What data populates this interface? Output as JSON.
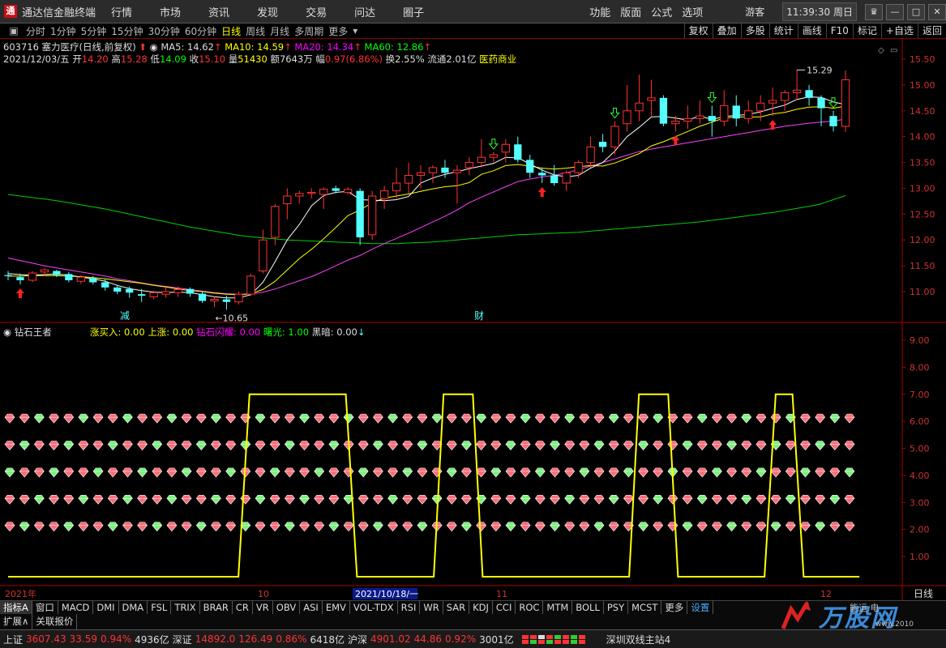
{
  "titlebar": {
    "app_title": "通达信金融终端",
    "menu": [
      "行情",
      "市场",
      "资讯",
      "发现",
      "交易",
      "问达",
      "圈子"
    ],
    "tools": [
      "功能",
      "版面",
      "公式",
      "选项"
    ],
    "user": "游客",
    "clock": "11:39:30 周日",
    "win_buttons": [
      "skin-icon",
      "minimize-icon",
      "maximize-icon",
      "close-icon"
    ]
  },
  "period_bar": {
    "items": [
      "分时",
      "1分钟",
      "5分钟",
      "15分钟",
      "30分钟",
      "60分钟",
      "日线",
      "周线",
      "月线",
      "多周期",
      "更多"
    ],
    "active": "日线",
    "right_tools": [
      "复权",
      "叠加",
      "多股",
      "统计",
      "画线",
      "F10",
      "标记",
      "+自选",
      "返回"
    ]
  },
  "stock": {
    "code_name": "603716 塞力医疗(日线,前复权)",
    "ma5": "MA5: 14.62",
    "ma10": "MA10: 14.59",
    "ma20": "MA20: 14.34",
    "ma60": "MA60: 12.86",
    "date": "2021/12/03/五",
    "open_lbl": "开",
    "open": "14.20",
    "high_lbl": "高",
    "high": "15.28",
    "low_lbl": "低",
    "low": "14.09",
    "close_lbl": "收",
    "close": "15.10",
    "vol_lbl": "量",
    "vol": "51430",
    "amt_lbl": "额",
    "amt": "7643万",
    "chg_lbl": "幅",
    "chg": "0.97(6.86%)",
    "turnover": "换2.55%",
    "float": "流通2.01亿",
    "sector": "医药商业"
  },
  "indicator": {
    "name": "钻石王者",
    "zmr": "涨买入: 0.00",
    "sz": "上涨: 0.00",
    "zsxy": "钻石闪耀: 0.00",
    "sg": "曙光: 1.00",
    "ha": "黑暗: 0.00"
  },
  "chart_data": {
    "type": "candlestick",
    "price_axis": {
      "ticks": [
        "15.50",
        "15.00",
        "14.50",
        "14.00",
        "13.50",
        "13.00",
        "12.50",
        "12.00",
        "11.50",
        "11.00"
      ]
    },
    "indicator_axis": {
      "ticks": [
        "9.00",
        "8.00",
        "7.00",
        "6.00",
        "5.00",
        "4.00",
        "3.00",
        "2.00",
        "1.00"
      ],
      "range": [
        0,
        9.5
      ]
    },
    "price_range": [
      10.5,
      15.7
    ],
    "annotations": {
      "low_label": "←10.65",
      "high_label": "15.29",
      "jian": "减",
      "cai": "财"
    },
    "x_axis_labels": {
      "year": "2021年",
      "oct": "10",
      "nov": "11",
      "dec": "12",
      "cursor_date": "2021/10/18/一",
      "period": "日线"
    },
    "candles": [
      [
        11.32,
        11.4,
        11.22,
        11.3
      ],
      [
        11.28,
        11.35,
        11.14,
        11.22
      ],
      [
        11.22,
        11.4,
        11.18,
        11.36
      ],
      [
        11.38,
        11.45,
        11.3,
        11.42
      ],
      [
        11.4,
        11.42,
        11.28,
        11.32
      ],
      [
        11.34,
        11.38,
        11.18,
        11.22
      ],
      [
        11.2,
        11.32,
        11.15,
        11.28
      ],
      [
        11.26,
        11.3,
        11.14,
        11.18
      ],
      [
        11.18,
        11.24,
        11.02,
        11.08
      ],
      [
        11.08,
        11.12,
        10.95,
        11.0
      ],
      [
        11.05,
        11.1,
        10.88,
        10.98
      ],
      [
        10.95,
        11.05,
        10.8,
        10.92
      ],
      [
        10.9,
        11.02,
        10.85,
        10.98
      ],
      [
        10.95,
        11.08,
        10.88,
        11.0
      ],
      [
        10.98,
        11.1,
        10.9,
        11.04
      ],
      [
        11.05,
        11.08,
        10.9,
        10.96
      ],
      [
        10.96,
        11.0,
        10.78,
        10.82
      ],
      [
        10.82,
        10.9,
        10.7,
        10.85
      ],
      [
        10.85,
        10.92,
        10.65,
        10.8
      ],
      [
        10.8,
        11.0,
        10.75,
        10.95
      ],
      [
        10.95,
        11.35,
        10.92,
        11.3
      ],
      [
        11.4,
        12.2,
        11.35,
        12.0
      ],
      [
        12.05,
        12.7,
        11.9,
        12.65
      ],
      [
        12.7,
        13.0,
        12.4,
        12.85
      ],
      [
        12.85,
        12.95,
        12.7,
        12.9
      ],
      [
        12.9,
        13.0,
        12.8,
        12.92
      ],
      [
        12.88,
        13.02,
        12.6,
        12.98
      ],
      [
        13.0,
        13.05,
        12.9,
        12.95
      ],
      [
        12.92,
        13.02,
        12.88,
        12.98
      ],
      [
        12.95,
        13.0,
        11.9,
        12.05
      ],
      [
        12.1,
        12.95,
        12.0,
        12.85
      ],
      [
        12.8,
        13.05,
        12.6,
        12.95
      ],
      [
        12.95,
        13.4,
        12.8,
        13.1
      ],
      [
        13.1,
        13.5,
        12.9,
        13.25
      ],
      [
        13.25,
        13.45,
        13.0,
        13.3
      ],
      [
        13.3,
        13.45,
        13.1,
        13.4
      ],
      [
        13.4,
        13.55,
        13.2,
        13.3
      ],
      [
        13.3,
        13.45,
        12.7,
        13.35
      ],
      [
        13.4,
        13.6,
        13.25,
        13.5
      ],
      [
        13.5,
        13.95,
        13.4,
        13.6
      ],
      [
        13.6,
        13.7,
        13.5,
        13.65
      ],
      [
        13.7,
        13.95,
        13.5,
        13.85
      ],
      [
        13.85,
        14.0,
        13.5,
        13.55
      ],
      [
        13.55,
        13.65,
        13.2,
        13.3
      ],
      [
        13.3,
        13.4,
        13.1,
        13.25
      ],
      [
        13.25,
        13.45,
        13.05,
        13.1
      ],
      [
        13.1,
        13.35,
        12.95,
        13.3
      ],
      [
        13.3,
        13.55,
        13.2,
        13.5
      ],
      [
        13.5,
        14.0,
        13.4,
        13.8
      ],
      [
        13.9,
        14.05,
        13.7,
        13.8
      ],
      [
        13.8,
        14.3,
        13.65,
        14.2
      ],
      [
        14.25,
        15.0,
        14.1,
        14.5
      ],
      [
        14.5,
        15.2,
        14.3,
        14.65
      ],
      [
        14.7,
        15.1,
        14.4,
        14.75
      ],
      [
        14.75,
        14.8,
        14.2,
        14.25
      ],
      [
        14.25,
        14.4,
        14.1,
        14.3
      ],
      [
        14.3,
        14.6,
        14.15,
        14.35
      ],
      [
        14.35,
        14.7,
        14.25,
        14.4
      ],
      [
        14.4,
        14.6,
        14.0,
        14.3
      ],
      [
        14.3,
        14.9,
        14.2,
        14.6
      ],
      [
        14.6,
        14.8,
        14.2,
        14.35
      ],
      [
        14.35,
        14.7,
        14.25,
        14.5
      ],
      [
        14.5,
        14.8,
        14.3,
        14.65
      ],
      [
        14.65,
        14.95,
        14.4,
        14.7
      ],
      [
        14.7,
        14.9,
        14.5,
        14.85
      ],
      [
        14.85,
        15.29,
        14.7,
        14.9
      ],
      [
        14.9,
        15.0,
        14.6,
        14.75
      ],
      [
        14.75,
        14.8,
        14.2,
        14.55
      ],
      [
        14.4,
        14.5,
        14.1,
        14.2
      ],
      [
        14.2,
        15.28,
        14.09,
        15.1
      ]
    ],
    "ma5": [
      11.35,
      11.33,
      11.32,
      11.33,
      11.34,
      11.32,
      11.28,
      11.25,
      11.2,
      11.12,
      11.06,
      11.02,
      10.99,
      10.98,
      10.99,
      10.98,
      10.94,
      10.9,
      10.88,
      10.88,
      10.94,
      11.18,
      11.58,
      12.0,
      12.3,
      12.66,
      12.86,
      12.92,
      12.94,
      12.78,
      12.77,
      12.76,
      12.78,
      12.84,
      13.1,
      13.2,
      13.27,
      13.32,
      13.38,
      13.43,
      13.48,
      13.6,
      13.59,
      13.47,
      13.35,
      13.26,
      13.22,
      13.25,
      13.39,
      13.5,
      13.72,
      14.0,
      14.18,
      14.38,
      14.39,
      14.36,
      14.32,
      14.4,
      14.33,
      14.39,
      14.41,
      14.43,
      14.48,
      14.55,
      14.61,
      14.72,
      14.77,
      14.76,
      14.67,
      14.62
    ],
    "ma10": [
      11.3,
      11.3,
      11.31,
      11.31,
      11.31,
      11.3,
      11.29,
      11.27,
      11.25,
      11.22,
      11.19,
      11.16,
      11.12,
      11.09,
      11.05,
      11.02,
      11.0,
      10.97,
      10.95,
      10.94,
      10.96,
      11.04,
      11.2,
      11.42,
      11.64,
      11.82,
      12.02,
      12.24,
      12.47,
      12.58,
      12.72,
      12.81,
      12.85,
      12.89,
      12.94,
      12.99,
      13.03,
      13.05,
      13.11,
      13.27,
      13.34,
      13.44,
      13.46,
      13.43,
      13.39,
      13.37,
      13.39,
      13.42,
      13.44,
      13.43,
      13.49,
      13.58,
      13.67,
      13.82,
      13.9,
      14.0,
      14.1,
      14.2,
      14.28,
      14.36,
      14.38,
      14.38,
      14.38,
      14.44,
      14.47,
      14.53,
      14.57,
      14.58,
      14.55,
      14.59
    ],
    "ma20": [
      11.65,
      11.6,
      11.55,
      11.5,
      11.46,
      11.42,
      11.38,
      11.34,
      11.3,
      11.25,
      11.21,
      11.17,
      11.13,
      11.1,
      11.07,
      11.04,
      11.01,
      10.98,
      10.96,
      10.95,
      10.95,
      10.99,
      11.05,
      11.13,
      11.21,
      11.29,
      11.39,
      11.5,
      11.61,
      11.7,
      11.82,
      11.93,
      12.03,
      12.13,
      12.24,
      12.35,
      12.46,
      12.58,
      12.72,
      12.83,
      12.93,
      13.03,
      13.13,
      13.18,
      13.22,
      13.25,
      13.3,
      13.36,
      13.43,
      13.5,
      13.57,
      13.64,
      13.71,
      13.76,
      13.8,
      13.84,
      13.88,
      13.92,
      13.96,
      14.0,
      14.04,
      14.08,
      14.12,
      14.16,
      14.2,
      14.23,
      14.26,
      14.28,
      14.3,
      14.34
    ],
    "ma60": [
      12.88,
      12.85,
      12.82,
      12.79,
      12.76,
      12.72,
      12.68,
      12.64,
      12.6,
      12.55,
      12.5,
      12.45,
      12.4,
      12.35,
      12.3,
      12.25,
      12.21,
      12.17,
      12.13,
      12.09,
      12.06,
      12.04,
      12.02,
      12.0,
      11.99,
      11.98,
      11.97,
      11.96,
      11.95,
      11.94,
      11.93,
      11.93,
      11.93,
      11.94,
      11.95,
      11.96,
      11.98,
      12.0,
      12.02,
      12.04,
      12.06,
      12.08,
      12.1,
      12.11,
      12.12,
      12.13,
      12.14,
      12.15,
      12.17,
      12.19,
      12.21,
      12.23,
      12.25,
      12.27,
      12.29,
      12.31,
      12.33,
      12.35,
      12.38,
      12.41,
      12.44,
      12.47,
      12.5,
      12.53,
      12.57,
      12.61,
      12.65,
      12.7,
      12.78,
      12.86
    ],
    "buy_arrows": [
      1,
      44,
      55,
      63
    ],
    "hollow_arrows": [
      40,
      50,
      58,
      68
    ],
    "step_line": [
      [
        0,
        0.25
      ],
      [
        16.5,
        0.25
      ],
      [
        17.3,
        7
      ],
      [
        24.2,
        7
      ],
      [
        25,
        0.25
      ],
      [
        30.5,
        0.25
      ],
      [
        31.2,
        7
      ],
      [
        33.3,
        7
      ],
      [
        34,
        0.25
      ],
      [
        44.5,
        0.25
      ],
      [
        45.2,
        7
      ],
      [
        47.3,
        7
      ],
      [
        48,
        0.25
      ],
      [
        54.2,
        0.25
      ],
      [
        55,
        7
      ],
      [
        56.2,
        7
      ],
      [
        57,
        0.25
      ],
      [
        61,
        0.25
      ]
    ],
    "diamond_rows": [
      6,
      5,
      4,
      3,
      2
    ]
  },
  "tabs1": [
    "指标A",
    "窗口",
    "MACD",
    "DMI",
    "DMA",
    "FSL",
    "TRIX",
    "BRAR",
    "CR",
    "VR",
    "OBV",
    "ASI",
    "EMV",
    "VOL-TDX",
    "RSI",
    "WR",
    "SAR",
    "KDJ",
    "CCI",
    "ROC",
    "MTM",
    "BOLL",
    "PSY",
    "MCST",
    "更多",
    "设置"
  ],
  "tabs2": [
    "扩展∧",
    "关联报价"
  ],
  "status": {
    "sh_lbl": "上证",
    "sh_idx": "3607.43",
    "sh_chg": "33.59",
    "sh_pct": "0.94%",
    "sh_vol": "4936亿",
    "sz_lbl": "深证",
    "sz_idx": "14892.0",
    "sz_chg": "126.49",
    "sz_pct": "0.86%",
    "sz_vol": "6418亿",
    "hs_lbl": "沪深",
    "hs_idx": "4901.02",
    "hs_chg": "44.86",
    "hs_pct": "0.92%",
    "hs_vol": "3001亿",
    "station": "深圳双线主站4"
  },
  "watermark": {
    "main": "万股网",
    "sub": "www.2010",
    "side": "能运 电"
  },
  "colors": {
    "up": "#ff3232",
    "down": "#54ffff",
    "ma5": "#ffffff",
    "ma10": "#ffff00",
    "ma20": "#ff40ff",
    "ma60": "#00d000",
    "step": "#ffff00",
    "axis": "#aa0000"
  }
}
